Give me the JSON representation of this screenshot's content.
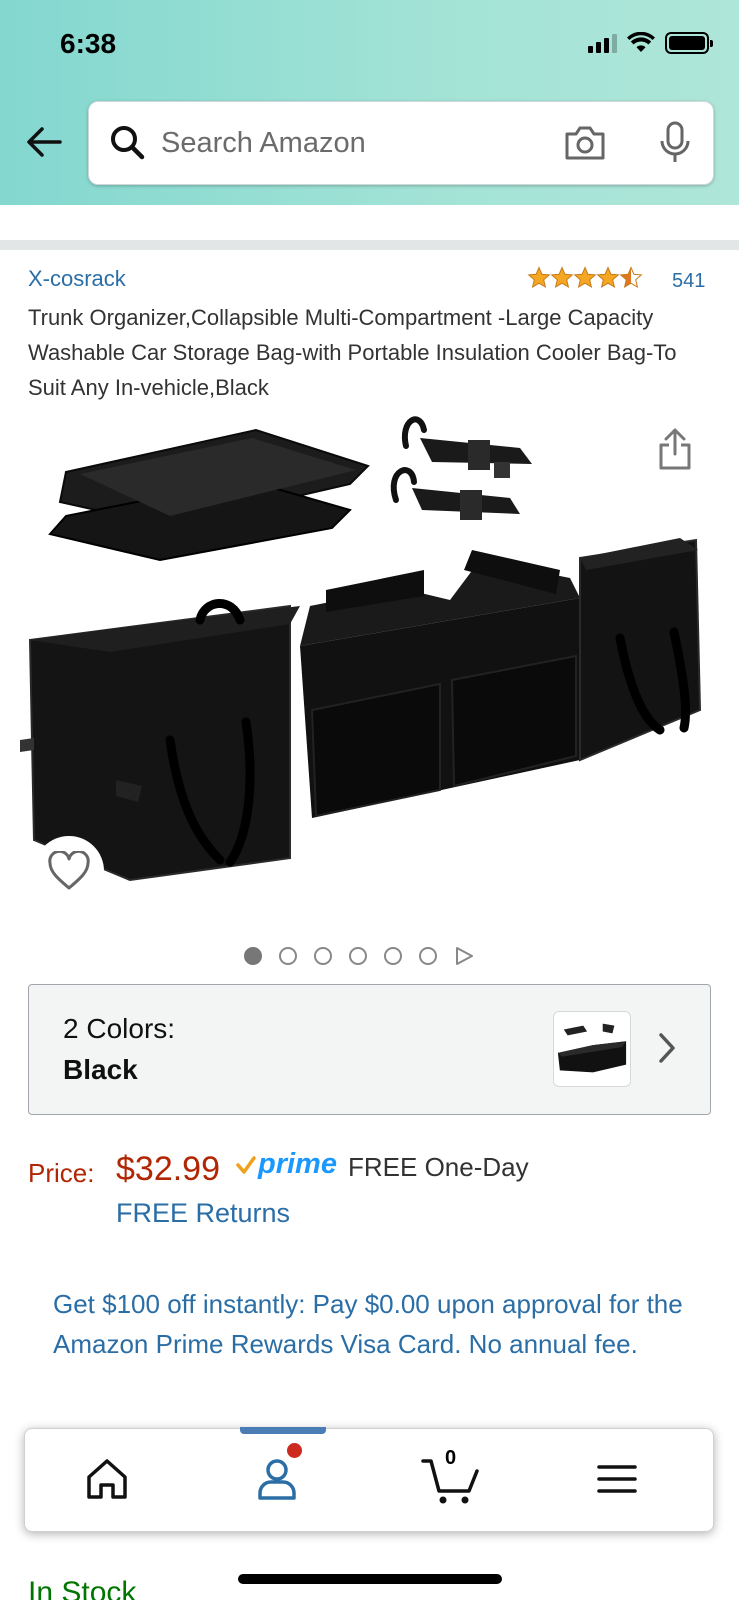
{
  "status_bar": {
    "time": "6:38"
  },
  "search": {
    "placeholder": "Search Amazon"
  },
  "product": {
    "brand": "X-cosrack",
    "rating": 4.5,
    "review_count": "541",
    "title": "Trunk Organizer,Collapsible Multi-Compartment -Large Capacity Washable Car Storage Bag-with Portable Insulation Cooler Bag-To Suit Any In-vehicle,Black",
    "image_count": 6,
    "active_image": 1
  },
  "colors": {
    "label": "2 Colors:",
    "selected": "Black"
  },
  "pricing": {
    "label": "Price:",
    "value": "$32.99",
    "prime_label": "prime",
    "delivery": "FREE One-Day",
    "returns": "FREE Returns"
  },
  "promo": {
    "text": "Get $100 off instantly: Pay $0.00 upon approval for the Amazon Prime Rewards Visa Card. No annual fee."
  },
  "stock": {
    "text": "In Stock"
  },
  "bottom_nav": {
    "cart_count": "0",
    "items": [
      "home-icon",
      "account-icon",
      "cart-icon",
      "menu-icon"
    ]
  },
  "colors_theme": {
    "link": "#2b6ea6",
    "price": "#b12704",
    "prime": "#1a98ff",
    "star": "#de7921"
  }
}
